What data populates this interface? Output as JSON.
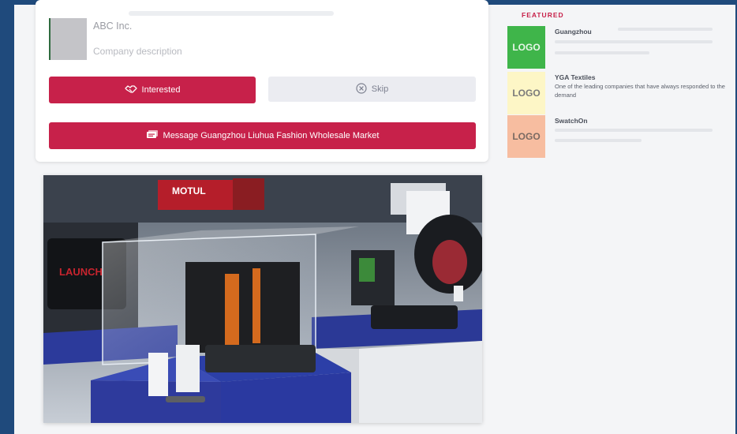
{
  "company": {
    "name": "ABC Inc.",
    "description": "Company description"
  },
  "actions": {
    "interested_label": "Interested",
    "skip_label": "Skip",
    "message_label": "Message Guangzhou Liuhua Fashion Wholesale Market"
  },
  "featured": {
    "title": "FEATURED",
    "items": [
      {
        "logo": "LOGO",
        "name": "Guangzhou",
        "description": "",
        "logo_color": "#3fb54a"
      },
      {
        "logo": "LOGO",
        "name": "YGA Textiles",
        "description": "One of the leading companies that have always responded to the demand",
        "logo_color": "#fdf6c6"
      },
      {
        "logo": "LOGO",
        "name": "SwatchOn",
        "description": "",
        "logo_color": "#f7bda0"
      }
    ]
  },
  "photo": {
    "sign_text": "MOTUL",
    "case_text": "LAUNCH"
  },
  "colors": {
    "accent": "#c7214a",
    "background": "#1f4a7c"
  }
}
